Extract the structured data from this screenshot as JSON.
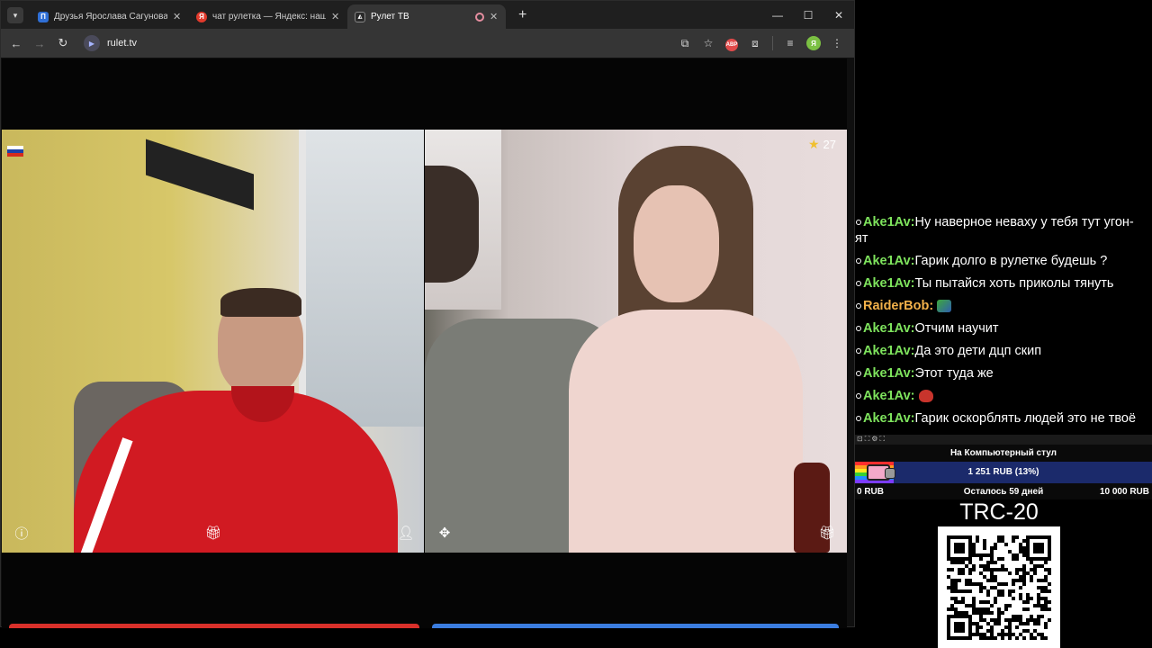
{
  "browser": {
    "tabs": [
      {
        "title": "Друзья Ярослава Сагунова – З",
        "favicon_color": "#2f6fd6",
        "favicon_letter": "П",
        "active": false
      },
      {
        "title": "чат рулетка — Яндекс: нашлос",
        "favicon_color": "#e13a2c",
        "favicon_letter": "Я",
        "active": false
      },
      {
        "title": "Рулет ТВ",
        "favicon_color": "#2a2a2a",
        "favicon_letter": "R",
        "active": true
      }
    ],
    "url": "rulet.tv",
    "profile_letter": "Я",
    "extension_badge": "ABP"
  },
  "call": {
    "rating": "27"
  },
  "chat": {
    "messages": [
      {
        "user": "Ake1Av",
        "text": "Ну наверное неваху у тебя тут угон-",
        "cont": "ят",
        "user_color": "green"
      },
      {
        "user": "Ake1Av",
        "text": "Гарик долго в рулетке будешь ?",
        "user_color": "green"
      },
      {
        "user": "Ake1Av",
        "text": "Ты пытайся хоть приколы тянуть",
        "user_color": "green"
      },
      {
        "user": "RaiderBob",
        "text": "",
        "emote": "green-emote",
        "user_color": "orange"
      },
      {
        "user": "Ake1Av",
        "text": "Отчим научит",
        "user_color": "green"
      },
      {
        "user": "Ake1Av",
        "text": "Да это дети дцп скип",
        "user_color": "green"
      },
      {
        "user": "Ake1Av",
        "text": "Этот туда же",
        "user_color": "green"
      },
      {
        "user": "Ake1Av",
        "text": "",
        "emote": "red-emote",
        "user_color": "green"
      },
      {
        "user": "Ake1Av",
        "text": "Гарик оскорблять людей это не твоё",
        "user_color": "green"
      }
    ]
  },
  "goal": {
    "title": "На Компьютерный стул",
    "amount": "1 251 RUB (13%)",
    "progress_fraction": 0.13,
    "min": "0 RUB",
    "remaining": "Осталось 59 дней",
    "max": "10 000 RUB"
  },
  "donation": {
    "label": "TRC-20"
  }
}
